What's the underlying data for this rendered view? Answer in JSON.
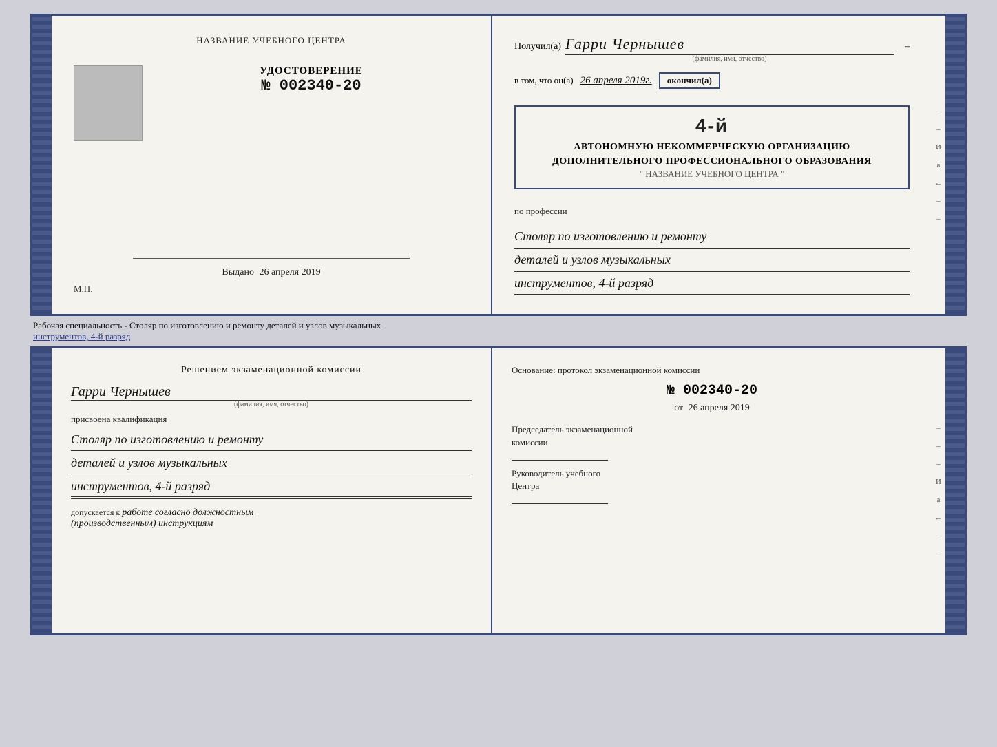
{
  "top": {
    "left": {
      "title": "НАЗВАНИЕ УЧЕБНОГО ЦЕНТРА",
      "udostoverenie_label": "УДОСТОВЕРЕНИЕ",
      "number": "№ 002340-20",
      "vydano_label": "Выдано",
      "vydano_date": "26 апреля 2019",
      "mp": "М.П."
    },
    "right": {
      "poluchil_prefix": "Получил(а)",
      "name_handwritten": "Гарри Чернышев",
      "name_subtitle": "(фамилия, имя, отчество)",
      "vtom_prefix": "в том, что он(а)",
      "date_handwritten": "26 апреля 2019г.",
      "okonchil": "окончил(а)",
      "stamp_line1": "АВТОНОМНУЮ НЕКОММЕРЧЕСКУЮ ОРГАНИЗАЦИЮ",
      "stamp_line2": "ДОПОЛНИТЕЛЬНОГО ПРОФЕССИОНАЛЬНОГО ОБРАЗОВАНИЯ",
      "stamp_line3": "\" НАЗВАНИЕ УЧЕБНОГО ЦЕНТРА \"",
      "po_professii": "по профессии",
      "profession_line1": "Столяр по изготовлению и ремонту",
      "profession_line2": "деталей и узлов музыкальных",
      "profession_line3": "инструментов, 4-й разряд"
    }
  },
  "caption": {
    "text": "Рабочая специальность - Столяр по изготовлению и ремонту деталей и узлов музыкальных",
    "text2": "инструментов, 4-й разряд"
  },
  "bottom": {
    "left": {
      "resheniem_title": "Решением  экзаменационной  комиссии",
      "name_handwritten": "Гарри Чернышев",
      "name_subtitle": "(фамилия, имя, отчество)",
      "prisvoena": "присвоена квалификация",
      "qual_line1": "Столяр по изготовлению и ремонту",
      "qual_line2": "деталей и узлов музыкальных",
      "qual_line3": "инструментов, 4-й разряд",
      "dopuskaetsya_prefix": "допускается к",
      "dopuskaetsya_italic": "работе согласно должностным",
      "dopuskaetsya_italic2": "(производственным) инструкциям"
    },
    "right": {
      "osnovanie": "Основание:  протокол  экзаменационной  комиссии",
      "number": "№  002340-20",
      "ot_prefix": "от",
      "ot_date": "26 апреля 2019",
      "predsedatel_line1": "Председатель экзаменационной",
      "predsedatel_line2": "комиссии",
      "rukovoditel_line1": "Руководитель учебного",
      "rukovoditel_line2": "Центра"
    }
  },
  "strip_chars": {
    "top": [
      "–",
      "–",
      "И",
      "а",
      "←",
      "–",
      "–",
      "–"
    ],
    "bottom": [
      "–",
      "–",
      "–",
      "И",
      "а",
      "←",
      "–",
      "–",
      "–"
    ]
  }
}
